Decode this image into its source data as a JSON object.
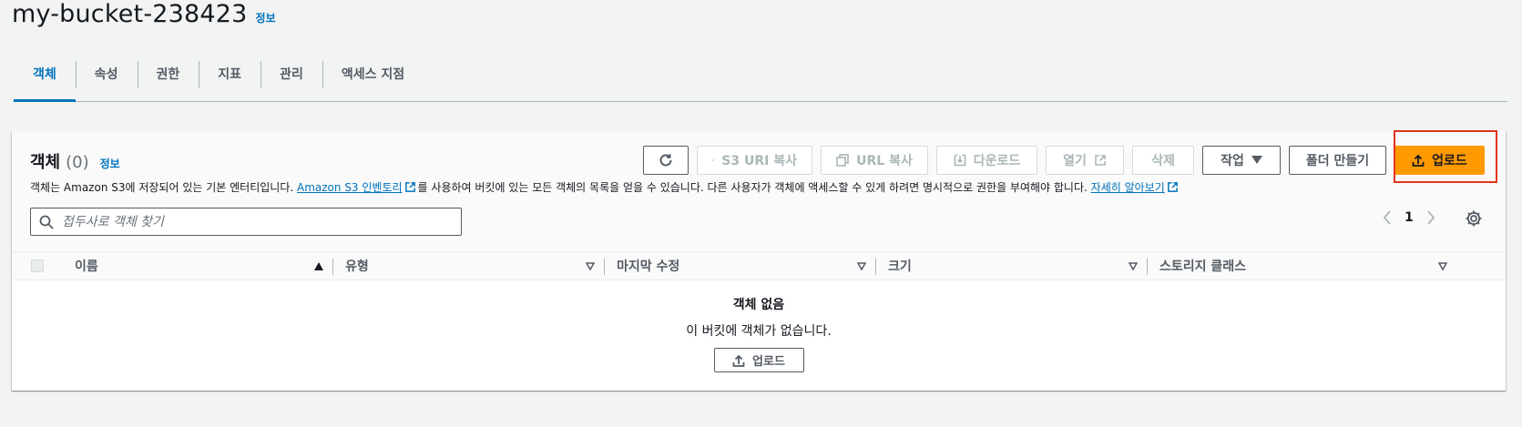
{
  "header": {
    "bucket_name": "my-bucket-238423",
    "info_label": "정보"
  },
  "tabs": [
    {
      "label": "객체",
      "active": true
    },
    {
      "label": "속성"
    },
    {
      "label": "권한"
    },
    {
      "label": "지표"
    },
    {
      "label": "관리"
    },
    {
      "label": "액세스 지점"
    }
  ],
  "objects_panel": {
    "title": "객체",
    "count": "(0)",
    "info_label": "정보",
    "toolbar": {
      "refresh_icon": "refresh-icon",
      "copy_s3_uri": "S3 URI 복사",
      "copy_url": "URL 복사",
      "download": "다운로드",
      "open": "열기",
      "delete": "삭제",
      "actions": "작업",
      "create_folder": "폴더 만들기",
      "upload": "업로드"
    },
    "description": {
      "part1": "객체는 Amazon S3에 저장되어 있는 기본 엔터티입니다. ",
      "link1": "Amazon S3 인벤토리",
      "part2": "를 사용하여 버킷에 있는 모든 객체의 목록을 얻을 수 있습니다. 다른 사용자가 객체에 액세스할 수 있게 하려면 명시적으로 권한을 부여해야 합니다. ",
      "link2": "자세히 알아보기"
    },
    "search": {
      "placeholder": "접두사로 객체 찾기",
      "value": ""
    },
    "pagination": {
      "current_page": "1"
    },
    "columns": [
      "이름",
      "유형",
      "마지막 수정",
      "크기",
      "스토리지 클래스"
    ],
    "empty_state": {
      "title": "객체 없음",
      "message": "이 버킷에 객체가 없습니다.",
      "upload_label": "업로드"
    }
  },
  "colors": {
    "primary": "#ff9900",
    "link": "#0073bb",
    "highlight": "#e0351b"
  }
}
